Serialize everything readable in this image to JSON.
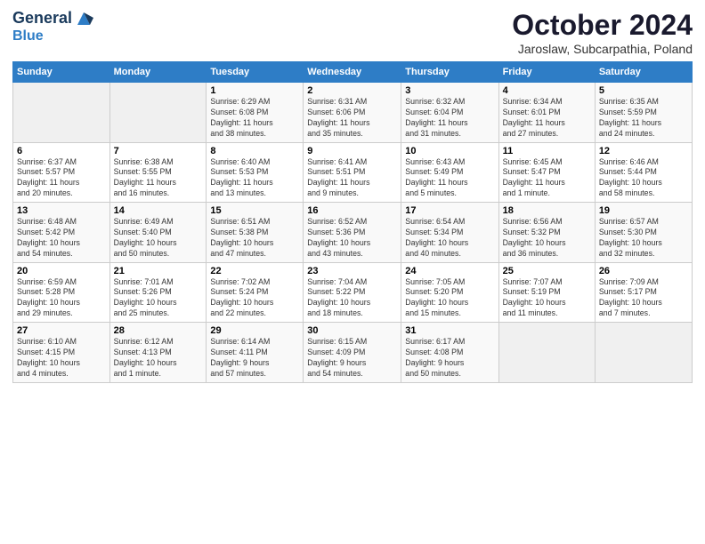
{
  "header": {
    "logo_line1": "General",
    "logo_line2": "Blue",
    "title": "October 2024",
    "subtitle": "Jaroslaw, Subcarpathia, Poland"
  },
  "columns": [
    "Sunday",
    "Monday",
    "Tuesday",
    "Wednesday",
    "Thursday",
    "Friday",
    "Saturday"
  ],
  "weeks": [
    {
      "days": [
        {
          "num": "",
          "info": "",
          "empty": true
        },
        {
          "num": "",
          "info": "",
          "empty": true
        },
        {
          "num": "1",
          "info": "Sunrise: 6:29 AM\nSunset: 6:08 PM\nDaylight: 11 hours\nand 38 minutes."
        },
        {
          "num": "2",
          "info": "Sunrise: 6:31 AM\nSunset: 6:06 PM\nDaylight: 11 hours\nand 35 minutes."
        },
        {
          "num": "3",
          "info": "Sunrise: 6:32 AM\nSunset: 6:04 PM\nDaylight: 11 hours\nand 31 minutes."
        },
        {
          "num": "4",
          "info": "Sunrise: 6:34 AM\nSunset: 6:01 PM\nDaylight: 11 hours\nand 27 minutes."
        },
        {
          "num": "5",
          "info": "Sunrise: 6:35 AM\nSunset: 5:59 PM\nDaylight: 11 hours\nand 24 minutes."
        }
      ]
    },
    {
      "days": [
        {
          "num": "6",
          "info": "Sunrise: 6:37 AM\nSunset: 5:57 PM\nDaylight: 11 hours\nand 20 minutes."
        },
        {
          "num": "7",
          "info": "Sunrise: 6:38 AM\nSunset: 5:55 PM\nDaylight: 11 hours\nand 16 minutes."
        },
        {
          "num": "8",
          "info": "Sunrise: 6:40 AM\nSunset: 5:53 PM\nDaylight: 11 hours\nand 13 minutes."
        },
        {
          "num": "9",
          "info": "Sunrise: 6:41 AM\nSunset: 5:51 PM\nDaylight: 11 hours\nand 9 minutes."
        },
        {
          "num": "10",
          "info": "Sunrise: 6:43 AM\nSunset: 5:49 PM\nDaylight: 11 hours\nand 5 minutes."
        },
        {
          "num": "11",
          "info": "Sunrise: 6:45 AM\nSunset: 5:47 PM\nDaylight: 11 hours\nand 1 minute."
        },
        {
          "num": "12",
          "info": "Sunrise: 6:46 AM\nSunset: 5:44 PM\nDaylight: 10 hours\nand 58 minutes."
        }
      ]
    },
    {
      "days": [
        {
          "num": "13",
          "info": "Sunrise: 6:48 AM\nSunset: 5:42 PM\nDaylight: 10 hours\nand 54 minutes."
        },
        {
          "num": "14",
          "info": "Sunrise: 6:49 AM\nSunset: 5:40 PM\nDaylight: 10 hours\nand 50 minutes."
        },
        {
          "num": "15",
          "info": "Sunrise: 6:51 AM\nSunset: 5:38 PM\nDaylight: 10 hours\nand 47 minutes."
        },
        {
          "num": "16",
          "info": "Sunrise: 6:52 AM\nSunset: 5:36 PM\nDaylight: 10 hours\nand 43 minutes."
        },
        {
          "num": "17",
          "info": "Sunrise: 6:54 AM\nSunset: 5:34 PM\nDaylight: 10 hours\nand 40 minutes."
        },
        {
          "num": "18",
          "info": "Sunrise: 6:56 AM\nSunset: 5:32 PM\nDaylight: 10 hours\nand 36 minutes."
        },
        {
          "num": "19",
          "info": "Sunrise: 6:57 AM\nSunset: 5:30 PM\nDaylight: 10 hours\nand 32 minutes."
        }
      ]
    },
    {
      "days": [
        {
          "num": "20",
          "info": "Sunrise: 6:59 AM\nSunset: 5:28 PM\nDaylight: 10 hours\nand 29 minutes."
        },
        {
          "num": "21",
          "info": "Sunrise: 7:01 AM\nSunset: 5:26 PM\nDaylight: 10 hours\nand 25 minutes."
        },
        {
          "num": "22",
          "info": "Sunrise: 7:02 AM\nSunset: 5:24 PM\nDaylight: 10 hours\nand 22 minutes."
        },
        {
          "num": "23",
          "info": "Sunrise: 7:04 AM\nSunset: 5:22 PM\nDaylight: 10 hours\nand 18 minutes."
        },
        {
          "num": "24",
          "info": "Sunrise: 7:05 AM\nSunset: 5:20 PM\nDaylight: 10 hours\nand 15 minutes."
        },
        {
          "num": "25",
          "info": "Sunrise: 7:07 AM\nSunset: 5:19 PM\nDaylight: 10 hours\nand 11 minutes."
        },
        {
          "num": "26",
          "info": "Sunrise: 7:09 AM\nSunset: 5:17 PM\nDaylight: 10 hours\nand 7 minutes."
        }
      ]
    },
    {
      "days": [
        {
          "num": "27",
          "info": "Sunrise: 6:10 AM\nSunset: 4:15 PM\nDaylight: 10 hours\nand 4 minutes."
        },
        {
          "num": "28",
          "info": "Sunrise: 6:12 AM\nSunset: 4:13 PM\nDaylight: 10 hours\nand 1 minute."
        },
        {
          "num": "29",
          "info": "Sunrise: 6:14 AM\nSunset: 4:11 PM\nDaylight: 9 hours\nand 57 minutes."
        },
        {
          "num": "30",
          "info": "Sunrise: 6:15 AM\nSunset: 4:09 PM\nDaylight: 9 hours\nand 54 minutes."
        },
        {
          "num": "31",
          "info": "Sunrise: 6:17 AM\nSunset: 4:08 PM\nDaylight: 9 hours\nand 50 minutes."
        },
        {
          "num": "",
          "info": "",
          "empty": true
        },
        {
          "num": "",
          "info": "",
          "empty": true
        }
      ]
    }
  ]
}
